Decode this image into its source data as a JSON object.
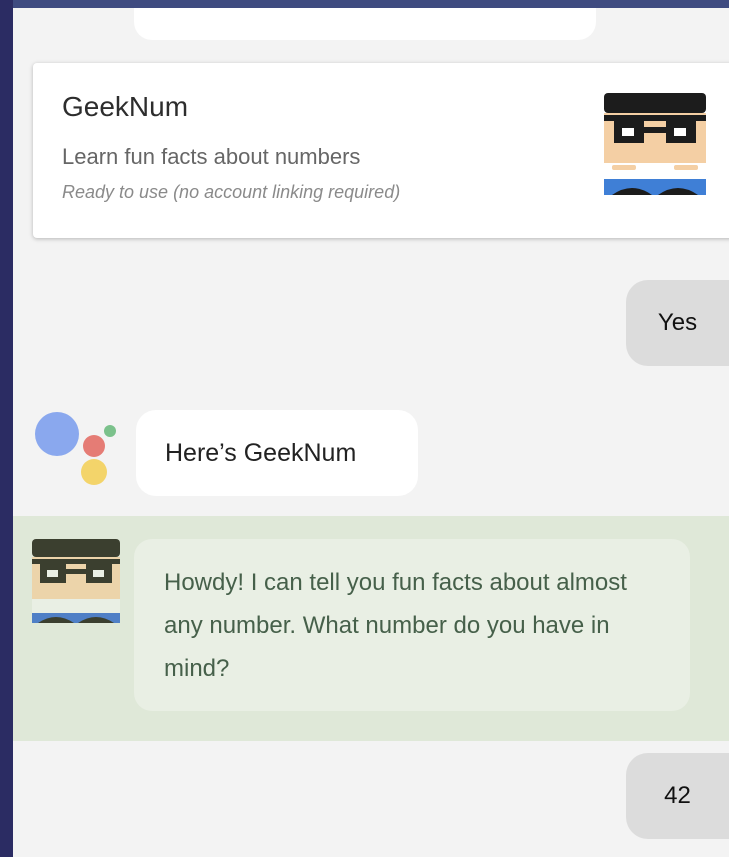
{
  "card": {
    "title": "GeekNum",
    "description": "Learn fun facts about numbers",
    "status": "Ready to use (no account linking required)",
    "avatar_icon": "geeknum-avatar-icon"
  },
  "conversation": {
    "user_reply_1": "Yes",
    "assistant_message": "Here’s GeekNum",
    "assistant_icon": "google-assistant-logo-icon",
    "geeknum_message": "Howdy! I can tell you fun facts about almost any number. What number do you have in mind?",
    "geeknum_icon": "geeknum-avatar-icon",
    "user_reply_2": "42"
  },
  "colors": {
    "frame": "#2b2c63",
    "panel": "#f3f3f3",
    "user_bubble": "#dcdcdc",
    "geek_section": "#dfe8d8",
    "geek_bubble": "#e9efe4",
    "geek_text": "#46604a"
  }
}
